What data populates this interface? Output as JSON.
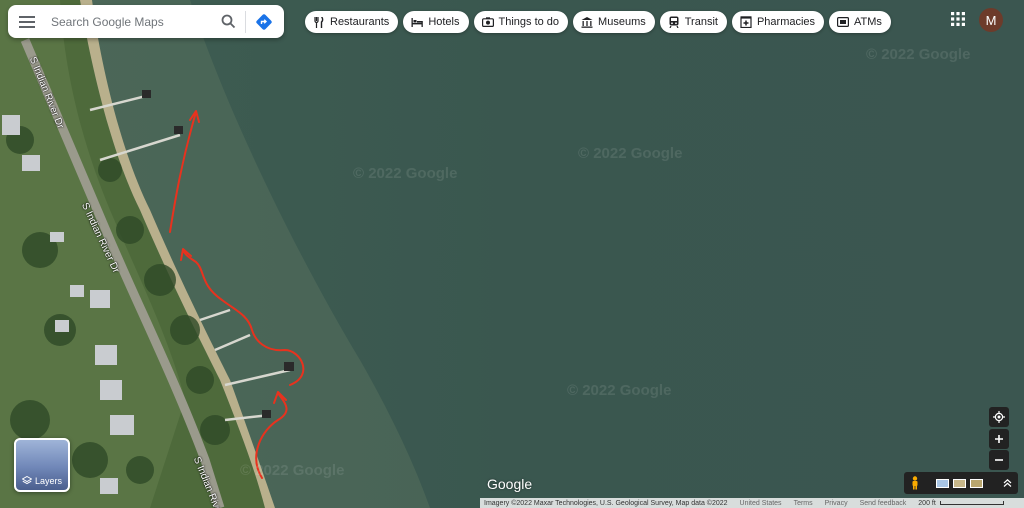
{
  "search": {
    "placeholder": "Search Google Maps"
  },
  "chips": [
    {
      "label": "Restaurants",
      "icon": "fork-knife-icon"
    },
    {
      "label": "Hotels",
      "icon": "bed-icon"
    },
    {
      "label": "Things to do",
      "icon": "camera-icon"
    },
    {
      "label": "Museums",
      "icon": "museum-icon"
    },
    {
      "label": "Transit",
      "icon": "train-icon"
    },
    {
      "label": "Pharmacies",
      "icon": "pharmacy-icon"
    },
    {
      "label": "ATMs",
      "icon": "atm-icon"
    }
  ],
  "account": {
    "initial": "M"
  },
  "map": {
    "watermarks": [
      "© 2022 Google",
      "© 2022 Google",
      "© 2022 Google",
      "© 2022 Google",
      "© 2022 Google"
    ],
    "road_labels": [
      "S Indian River Dr",
      "S Indian River Dr",
      "S Indian River"
    ]
  },
  "layers": {
    "label": "Layers"
  },
  "branding": {
    "logo": "Google"
  },
  "footer": {
    "imagery": "Imagery ©2022 Maxar Technologies, U.S. Geological Survey, Map data ©2022",
    "region": "United States",
    "terms": "Terms",
    "privacy": "Privacy",
    "feedback": "Send feedback",
    "scale": "200 ft"
  },
  "colors": {
    "arrow": "#e8321e",
    "water": "#3d5a52",
    "land": "#4f6b3a"
  }
}
